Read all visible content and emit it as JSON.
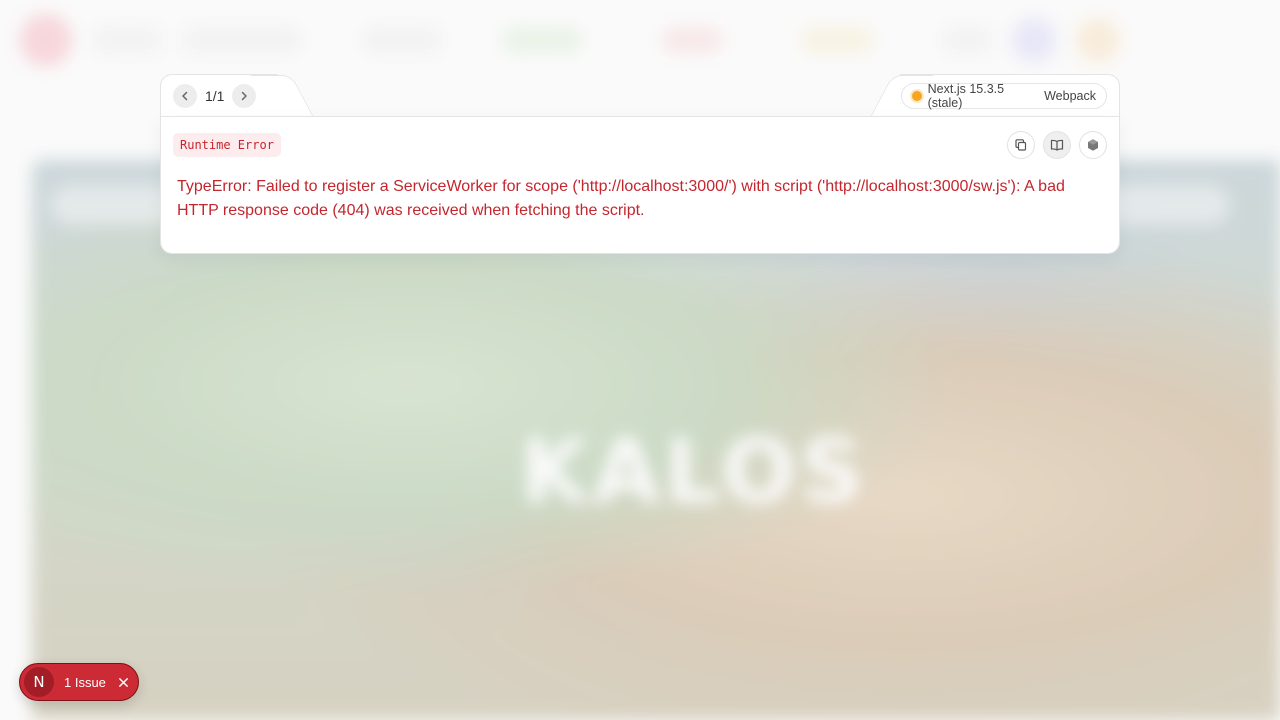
{
  "background": {
    "title": "KALOS"
  },
  "error_dialog": {
    "pager": {
      "text": "1/1",
      "prev_icon": "chevron-left-icon",
      "next_icon": "chevron-right-icon"
    },
    "version": {
      "label": "Next.js 15.3.5 (stale)",
      "bundler": "Webpack",
      "status_color": "#f5a623"
    },
    "error_type": "Runtime Error",
    "message": "TypeError: Failed to register a ServiceWorker for scope ('http://localhost:3000/') with script ('http://localhost:3000/sw.js'): A bad HTTP response code (404) was received when fetching the script.",
    "tools": [
      {
        "icon": "copy-icon"
      },
      {
        "icon": "book-icon"
      },
      {
        "icon": "nodejs-icon"
      }
    ],
    "accent_color": "#c4262e"
  },
  "issues_badge": {
    "logo": "N",
    "label": "1 Issue",
    "close_icon": "close-icon",
    "color": "#cc2a35"
  }
}
